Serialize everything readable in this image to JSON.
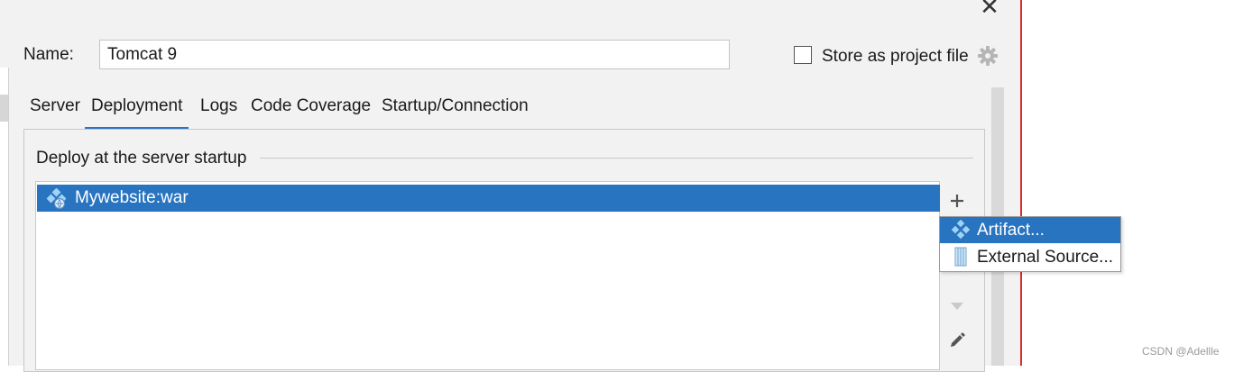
{
  "dialog": {
    "name_label": "Name:",
    "name_value": "Tomcat 9",
    "store_label": "Store as project file",
    "store_checked": false
  },
  "tabs": [
    {
      "label": "Server"
    },
    {
      "label": "Deployment"
    },
    {
      "label": "Logs"
    },
    {
      "label": "Code Coverage"
    },
    {
      "label": "Startup/Connection"
    }
  ],
  "active_tab": "Deployment",
  "deploy": {
    "group_title": "Deploy at the server startup",
    "items": [
      {
        "label": "Mywebsite:war",
        "icon": "artifact-icon",
        "selected": true
      }
    ]
  },
  "popup_menu": {
    "items": [
      {
        "label": "Artifact...",
        "icon": "artifact-icon",
        "highlighted": true
      },
      {
        "label": "External Source...",
        "icon": "external-source-icon",
        "highlighted": false
      }
    ]
  },
  "colors": {
    "accent": "#2874c0",
    "window_border": "#d9302f"
  },
  "watermark": "CSDN @Adellle"
}
